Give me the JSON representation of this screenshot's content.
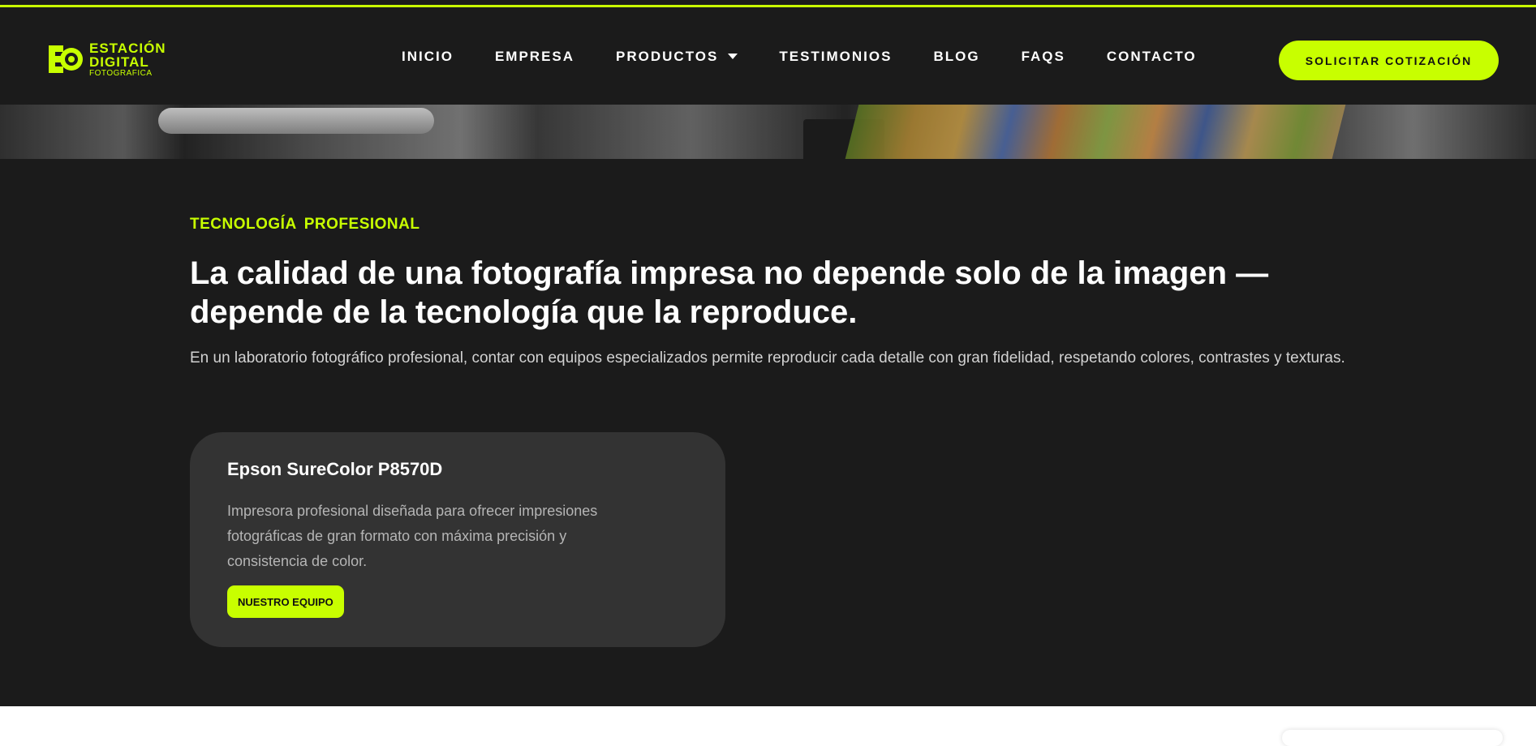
{
  "brand": {
    "line1": "ESTACIÓN",
    "line2": "DIGITAL",
    "line3": "FOTOGRAFICA",
    "accent_color": "#c8ff00",
    "background_color": "#1b1b1b"
  },
  "nav": {
    "items": [
      {
        "label": "INICIO"
      },
      {
        "label": "EMPRESA"
      },
      {
        "label": "PRODUCTOS",
        "icon": "caret-down-icon"
      },
      {
        "label": "TESTIMONIOS"
      },
      {
        "label": "BLOG"
      },
      {
        "label": "FAQS"
      },
      {
        "label": "CONTACTO"
      }
    ],
    "cta_label": "SOLICITAR COTIZACIÓN"
  },
  "section": {
    "eyebrow": "TECNOLOGÍA PROFESIONAL",
    "headline": "La calidad de una fotografía impresa no depende solo de la imagen — depende de la tecnología que la reproduce.",
    "lead": "En un laboratorio fotográfico profesional, contar con equipos especializados permite reproducir cada detalle con gran fidelidad, respetando colores, contrastes y texturas."
  },
  "card": {
    "title": "Epson SureColor P8570D",
    "description": "Impresora profesional diseñada para ofrecer impresiones fotográficas de gran formato con máxima precisión y consistencia de color.",
    "button_label": "NUESTRO EQUIPO",
    "background_color": "#333333"
  }
}
